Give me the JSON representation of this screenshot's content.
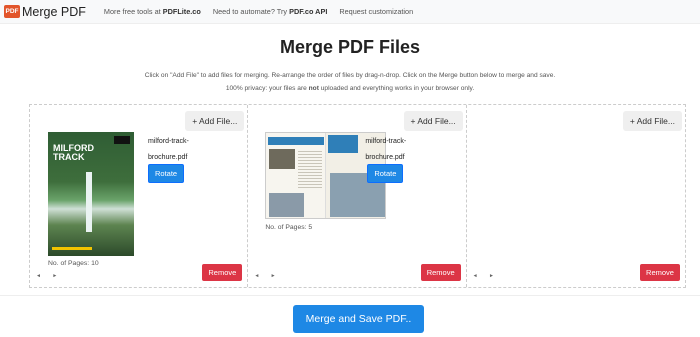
{
  "header": {
    "logo_badge": "PDF",
    "app_name": "Merge PDF",
    "nav": {
      "more_tools_prefix": "More free tools at ",
      "more_tools_link": "PDFLite.co",
      "automate_prefix": "Need to automate? Try ",
      "automate_link": "PDF.co API",
      "request": "Request customization"
    }
  },
  "page": {
    "title": "Merge PDF Files",
    "desc_line1": "Click on \"Add File\" to add files for merging. Re-arrange the order of files by drag-n-drop. Click on the Merge button below to merge and save.",
    "desc_line2_prefix": "100% privacy: your files are ",
    "desc_line2_bold": "not",
    "desc_line2_suffix": " uploaded and everything works in your browser only."
  },
  "slots": [
    {
      "add_label": "+ Add File...",
      "filename_line1": "milford-track-",
      "filename_line2": "brochure.pdf",
      "rotate_label": "Rotate",
      "pages_label": "No. of Pages: 10",
      "remove_label": "Remove",
      "arrows": "◄ ►",
      "thumb_title1": "MILFORD",
      "thumb_title2": "TRACK"
    },
    {
      "add_label": "+ Add File...",
      "filename_line1": "milford-track-",
      "filename_line2": "brochure.pdf",
      "rotate_label": "Rotate",
      "pages_label": "No. of Pages: 5",
      "remove_label": "Remove",
      "arrows": "◄ ►"
    },
    {
      "add_label": "+ Add File...",
      "remove_label": "Remove",
      "arrows": "◄ ►"
    }
  ],
  "merge_label": "Merge and Save PDF.."
}
